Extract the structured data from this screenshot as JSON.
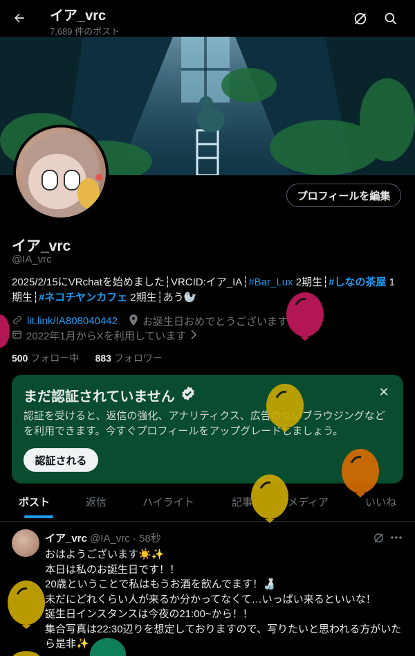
{
  "header": {
    "name": "イア_vrc",
    "post_count": "7,689 件のポスト"
  },
  "profile": {
    "edit_button": "プロフィールを編集",
    "name": "イア_vrc",
    "handle": "@IA_vrc",
    "bio_segments": [
      {
        "text": "2025/2/15にVRchatを始めました┆VRCID:イア_IA┆",
        "tag": false
      },
      {
        "text": "#Bar_Lux",
        "tag": true
      },
      {
        "text": " 2期生┆",
        "tag": false
      },
      {
        "text": "#しなの茶屋",
        "tag": true
      },
      {
        "text": " 1期生┆",
        "tag": false
      },
      {
        "text": "#ネコチヤンカフェ",
        "tag": true
      },
      {
        "text": " 2期生┆あう🦭",
        "tag": false
      }
    ],
    "link": "lit.link/IA808040442",
    "location": "お誕生日おめでとうございます",
    "joined": "2022年1月からXを利用しています",
    "following_count": "500",
    "following_label": "フォロー中",
    "followers_count": "883",
    "followers_label": "フォロワー"
  },
  "verify_card": {
    "title": "まだ認証されていません",
    "body": "認証を受けると、返信の強化、アナリティクス、広告のないブラウジングなどを利用できます。今すぐプロフィールをアップグレードしましょう。",
    "button": "認証される"
  },
  "tabs": [
    "ポスト",
    "返信",
    "ハイライト",
    "記事",
    "メディア",
    "いいね"
  ],
  "post": {
    "name": "イア_vrc",
    "meta": "@IA_vrc · 58秒",
    "text": "おはようございます☀️✨\n本日は私のお誕生日です！！\n20歳ということで私はもうお酒を飲んでます！🍶\n未だにどれくらい人が来るか分かってなくて…いっぱい来るといいな！\n誕生日インスタンスは今夜の21:00~から！！\n集合写真は22:30辺りを想定しておりますので、写りたいと思われる方がいたら是非✨"
  },
  "colors": {
    "accent": "#1d9bf0",
    "card_bg": "#0a4c2f",
    "balloon_pink": "#c2185b",
    "balloon_yellow": "#c9a800",
    "balloon_orange": "#d96d00",
    "balloon_green": "#0f8a5f"
  },
  "icons": [
    "back-arrow-icon",
    "grok-icon",
    "search-icon",
    "link-icon",
    "location-icon",
    "calendar-icon",
    "verified-badge-icon",
    "close-icon",
    "more-icon"
  ]
}
